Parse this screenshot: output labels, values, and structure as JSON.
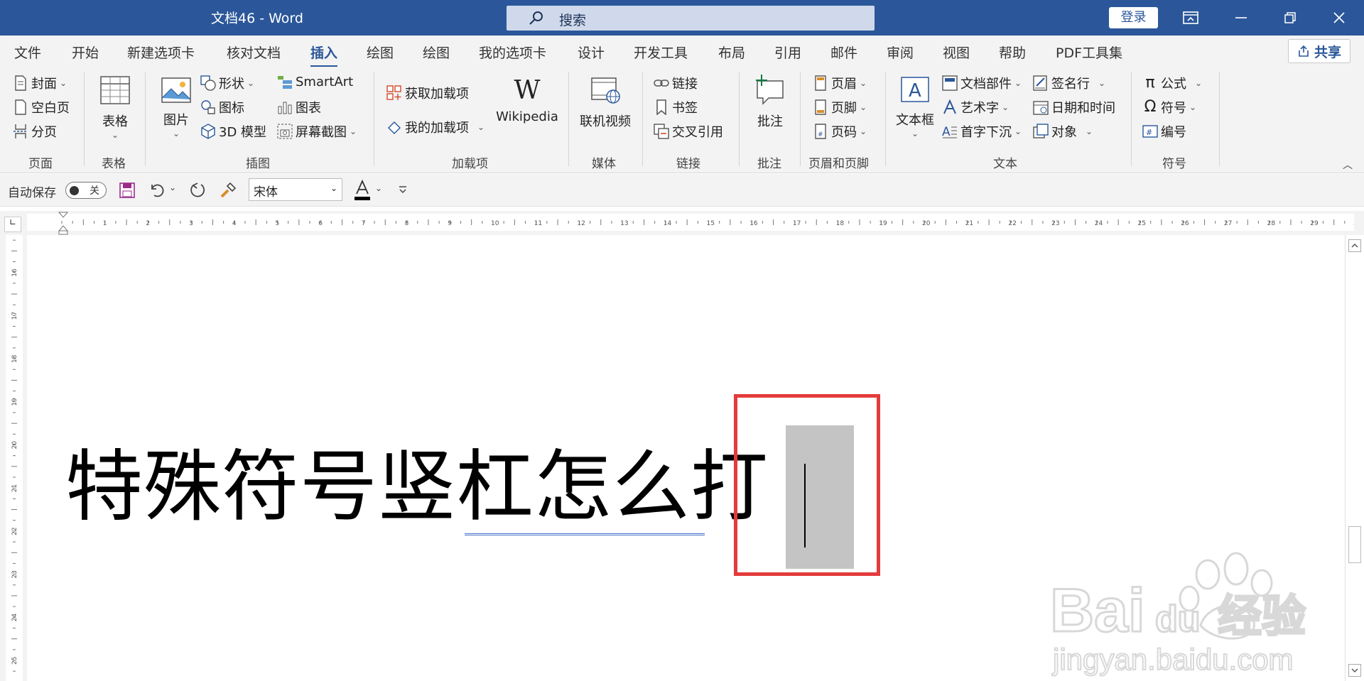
{
  "titlebar": {
    "doc_title": "文档46  -  Word",
    "search": "搜索",
    "login": "登录"
  },
  "tabs": [
    "文件",
    "开始",
    "新建选项卡",
    "核对文档",
    "插入",
    "绘图",
    "绘图",
    "我的选项卡",
    "设计",
    "开发工具",
    "布局",
    "引用",
    "邮件",
    "审阅",
    "视图",
    "帮助",
    "PDF工具集"
  ],
  "active_tab": "插入",
  "share": "共享",
  "ribbon": {
    "pages": {
      "cover": "封面",
      "blank": "空白页",
      "break": "分页",
      "label": "页面"
    },
    "tables": {
      "table": "表格",
      "label": "表格"
    },
    "illustrations": {
      "picture": "图片",
      "shapes": "形状",
      "icons": "图标",
      "model3d": "3D 模型",
      "smartart": "SmartArt",
      "chart": "图表",
      "screenshot": "屏幕截图",
      "label": "插图"
    },
    "addins": {
      "get": "获取加载项",
      "my": "我的加载项",
      "wikipedia": "Wikipedia",
      "label": "加载项"
    },
    "media": {
      "video": "联机视频",
      "label": "媒体"
    },
    "links": {
      "link": "链接",
      "bookmark": "书签",
      "crossref": "交叉引用",
      "label": "链接"
    },
    "comments": {
      "comment": "批注",
      "label": "批注"
    },
    "headerfooter": {
      "header": "页眉",
      "footer": "页脚",
      "pagenum": "页码",
      "label": "页眉和页脚"
    },
    "text": {
      "textbox": "文本框",
      "parts": "文档部件",
      "wordart": "艺术字",
      "dropcap": "首字下沉",
      "sigline": "签名行",
      "datetime": "日期和时间",
      "object": "对象",
      "label": "文本"
    },
    "symbols": {
      "equation": "公式",
      "symbol": "符号",
      "number": "编号",
      "label": "符号"
    }
  },
  "qat": {
    "autosave": "自动保存",
    "toggle": "关",
    "font": "宋体"
  },
  "document": {
    "text": "特殊符号竖杠怎么打"
  },
  "watermark": {
    "brand_a": "Bai",
    "brand_b": "du",
    "brand_c": "经验",
    "url": "jingyan.baidu.com"
  },
  "colors": {
    "titlebar": "#2b579a",
    "highlight_box": "#e43b3b",
    "selection": "#c4c4c4"
  }
}
